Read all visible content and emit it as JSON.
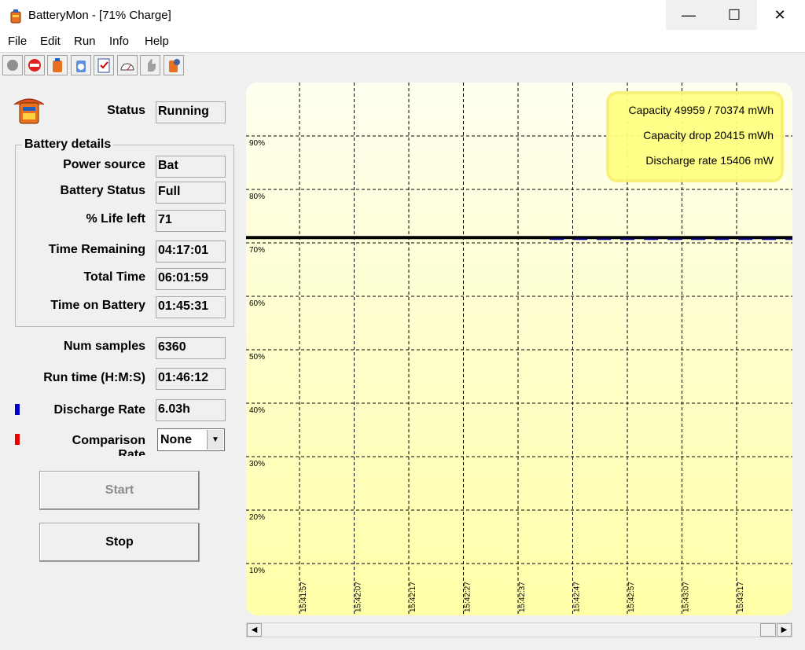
{
  "window": {
    "title": "BatteryMon - [71% Charge]",
    "min_glyph": "—",
    "max_glyph": "☐",
    "close_glyph": "✕"
  },
  "menu": [
    {
      "label": "File"
    },
    {
      "label": "Edit"
    },
    {
      "label": "Run"
    },
    {
      "label": "Info"
    },
    {
      "label": "Help"
    }
  ],
  "toolbar": {
    "icons": [
      "record-icon",
      "stop-icon",
      "battery-icon",
      "battery-info-icon",
      "checklist-icon",
      "gauge-icon",
      "thumbs-icon",
      "settings-icon"
    ]
  },
  "status": {
    "label": "Status",
    "value": "Running"
  },
  "details": {
    "title": "Battery details",
    "power_source": {
      "label": "Power source",
      "value": "Bat"
    },
    "battery_status": {
      "label": "Battery Status",
      "value": "Full"
    },
    "life_left": {
      "label": "% Life left",
      "value": "71"
    },
    "time_remaining": {
      "label": "Time Remaining",
      "value": "04:17:01"
    },
    "total_time": {
      "label": "Total Time",
      "value": "06:01:59"
    },
    "time_on_battery": {
      "label": "Time on Battery",
      "value": "01:45:31"
    }
  },
  "num_samples": {
    "label": "Num samples",
    "value": "6360"
  },
  "run_time": {
    "label": "Run time (H:M:S)",
    "value": "01:46:12"
  },
  "discharge_rate": {
    "label": "Discharge Rate",
    "value": "6.03h",
    "color": "#0000cc"
  },
  "comparison": {
    "label": "Comparison",
    "clipped_label": "Rate",
    "value": "None",
    "color": "#ee0000",
    "arrow": "▼"
  },
  "buttons": {
    "start": "Start",
    "stop": "Stop"
  },
  "scrollbar": {
    "left_arrow": "◀",
    "right_arrow": "▶"
  },
  "chart_data": {
    "type": "line",
    "y_ticks": [
      "90%",
      "80%",
      "70%",
      "60%",
      "50%",
      "40%",
      "30%",
      "20%",
      "10%"
    ],
    "x_ticks": [
      "15:41:57",
      "15:42:07",
      "15:42:17",
      "15:42:27",
      "15:42:37",
      "15:42:47",
      "15:42:57",
      "15:43:07",
      "15:43:17"
    ],
    "info": [
      "Capacity 49959 / 70374 mWh",
      "Capacity drop 20415 mWh",
      "Discharge rate 15406 mW"
    ],
    "series": [
      {
        "values": [
          71,
          71,
          71,
          71,
          71,
          71,
          71,
          71,
          71,
          71
        ],
        "color": "#000000"
      },
      {
        "values": [
          null,
          null,
          null,
          null,
          null,
          71,
          71,
          71,
          71,
          71
        ],
        "color": "#000088"
      }
    ],
    "ylim": [
      10,
      90
    ],
    "grid": true,
    "legend": "top-right",
    "colors": {
      "background": "#ffffa8",
      "info_box": "#ffff80"
    }
  }
}
